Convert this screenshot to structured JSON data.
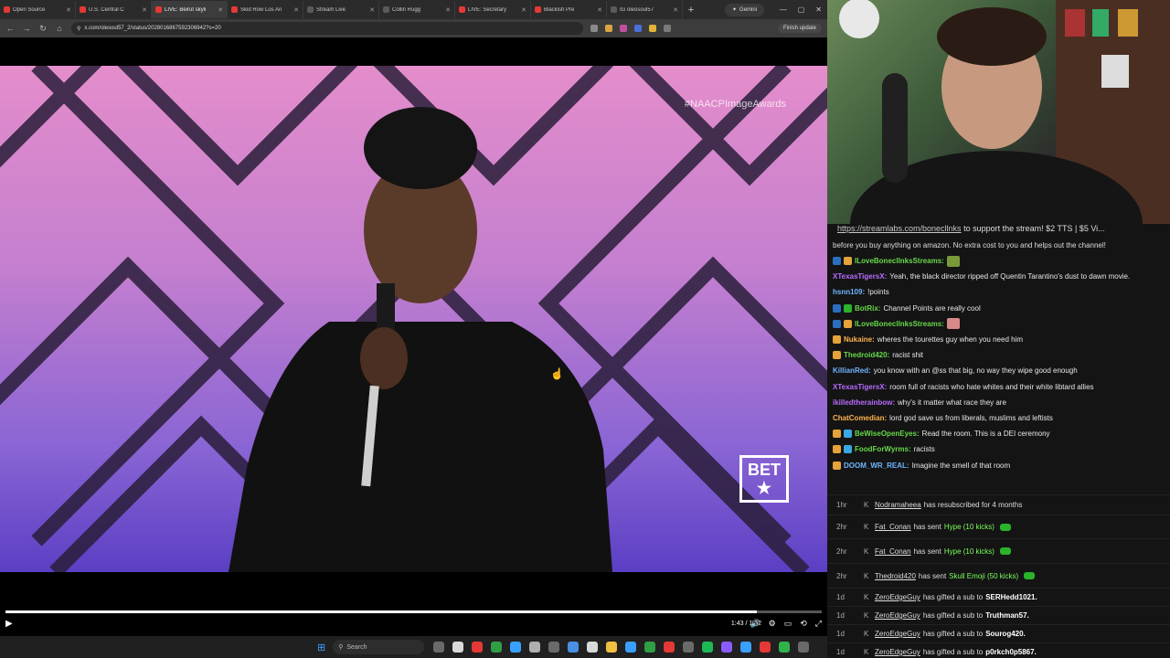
{
  "browser": {
    "tabs": [
      {
        "label": "Open Source",
        "color": "#e53935"
      },
      {
        "label": "U.S. Central C",
        "color": "#e53935"
      },
      {
        "label": "LIVE: Beirut skyli",
        "color": "#e53935",
        "active": true
      },
      {
        "label": "Skid Row Los An",
        "color": "#e53935"
      },
      {
        "label": "Stream Live",
        "color": "#5a5a5a"
      },
      {
        "label": "Collin Rugg",
        "color": "#5a5a5a"
      },
      {
        "label": "LIVE: Secretary",
        "color": "#e53935"
      },
      {
        "label": "Blackish Pre",
        "color": "#e53935"
      },
      {
        "label": "IG oleosoul57",
        "color": "#5a5a5a"
      }
    ],
    "gemini_label": "Gemini",
    "url": "x.com/olesoul57_2/status/2028016867592306942?s=20",
    "finish_update_label": "Finish update"
  },
  "video": {
    "hashtag": "#NAACPImageAwards",
    "network_logo": "BET",
    "timecode": "1:43 / 1:52",
    "progress": 0.92
  },
  "chat": {
    "ticker_link": "https://streamlabs.com/bonecllnks",
    "ticker_text": "to support the stream! $2 TTS | $5 Vi...",
    "pinned": "before you buy anything on amazon. No extra cost to you and helps out the channel!",
    "messages": [
      {
        "user": "ILoveBonecllnksStreams:",
        "text": "",
        "color": "#66d94a",
        "badges": [
          "#2a6fbf",
          "#e5a33a"
        ],
        "emote": "#7a9a3a"
      },
      {
        "user": "XTexasTigersX:",
        "text": "Yeah, the black director ripped off Quentin Tarantino's dust to dawn movie.",
        "color": "#b96bff",
        "badges": []
      },
      {
        "user": "hsnn109:",
        "text": "!points",
        "color": "#6fb5ff",
        "badges": []
      },
      {
        "user": "BotRix:",
        "text": "Channel Points are really cool",
        "color": "#66d94a",
        "badges": [
          "#2a6fbf",
          "#2bb32b"
        ]
      },
      {
        "user": "ILoveBonecllnksStreams:",
        "text": "",
        "color": "#66d94a",
        "badges": [
          "#2a6fbf",
          "#e5a33a"
        ],
        "emote": "#d88a8a"
      },
      {
        "user": "Nukaine:",
        "text": "wheres the tourettes guy when you need him",
        "color": "#ffb34d",
        "badges": [
          "#e5a33a"
        ]
      },
      {
        "user": "Thedroid420:",
        "text": "racist shit",
        "color": "#66d94a",
        "badges": [
          "#e5a33a"
        ]
      },
      {
        "user": "KillianRed:",
        "text": "you know with an @ss that big, no way they wipe good enough",
        "color": "#6fb5ff",
        "badges": []
      },
      {
        "user": "XTexasTigersX:",
        "text": "room full of racists who hate whites and their white libtard allies",
        "color": "#b96bff",
        "badges": []
      },
      {
        "user": "ikilledtherainbow:",
        "text": "why's it matter what race they are",
        "color": "#b96bff",
        "badges": []
      },
      {
        "user": "ChatComedian:",
        "text": "lord god save us from liberals, muslims and leftists",
        "color": "#ffb34d",
        "badges": []
      },
      {
        "user": "BeWiseOpenEyes:",
        "text": "Read the room. This is a DEI ceremony",
        "color": "#66d94a",
        "badges": [
          "#e5a33a",
          "#3aa7e5"
        ]
      },
      {
        "user": "FoodForWyrms:",
        "text": "racists",
        "color": "#66d94a",
        "badges": [
          "#e5a33a",
          "#3aa7e5"
        ]
      },
      {
        "user": "DOOM_WR_REAL:",
        "text": "Imagine the smell of that room",
        "color": "#6fb5ff",
        "badges": [
          "#e5a33a"
        ]
      }
    ]
  },
  "events": [
    {
      "time": "1hr",
      "user": "Nodramaheea",
      "pre": "has resubscribed for 4 months",
      "hl": "",
      "post": "",
      "pill": false,
      "strong": "",
      "height": 22
    },
    {
      "time": "2hr",
      "user": "Fat_Conan",
      "pre": "has sent",
      "hl": "Hype (10 kicks)",
      "post": "",
      "pill": true,
      "strong": "",
      "height": 26
    },
    {
      "time": "2hr",
      "user": "Fat_Conan",
      "pre": "has sent",
      "hl": "Hype (10 kicks)",
      "post": "",
      "pill": true,
      "strong": "",
      "height": 27
    },
    {
      "time": "2hr",
      "user": "Thedroid420",
      "pre": "has sent",
      "hl": "Skull Emoji (50 kicks)",
      "post": "",
      "pill": true,
      "strong": "",
      "height": 27
    },
    {
      "time": "1d",
      "user": "ZeroEdgeGuy",
      "pre": "has gifted a sub to",
      "hl": "",
      "post": "",
      "pill": false,
      "strong": "SERHedd1021.",
      "height": 20
    },
    {
      "time": "1d",
      "user": "ZeroEdgeGuy",
      "pre": "has gifted a sub to",
      "hl": "",
      "post": "",
      "pill": false,
      "strong": "Truthman57.",
      "height": 20
    },
    {
      "time": "1d",
      "user": "ZeroEdgeGuy",
      "pre": "has gifted a sub to",
      "hl": "",
      "post": "",
      "pill": false,
      "strong": "Sourog420.",
      "height": 20
    },
    {
      "time": "1d",
      "user": "ZeroEdgeGuy",
      "pre": "has gifted a sub to",
      "hl": "",
      "post": "",
      "pill": false,
      "strong": "p0rkch0p5867.",
      "height": 20
    }
  ],
  "taskbar": {
    "search_placeholder": "Search",
    "app_colors": [
      "#6a6a6a",
      "#d9d9d9",
      "#e53935",
      "#2f9e44",
      "#3aa0ff",
      "#b0b0b0",
      "#6a6a6a",
      "#4a90e2",
      "#d9d9d9",
      "#f0c040",
      "#3aa0ff",
      "#2f9e44",
      "#e53935",
      "#6a6a6a",
      "#1db954",
      "#8a5cff",
      "#3aa0ff",
      "#e53935",
      "#2fb34a",
      "#6a6a6a"
    ]
  }
}
